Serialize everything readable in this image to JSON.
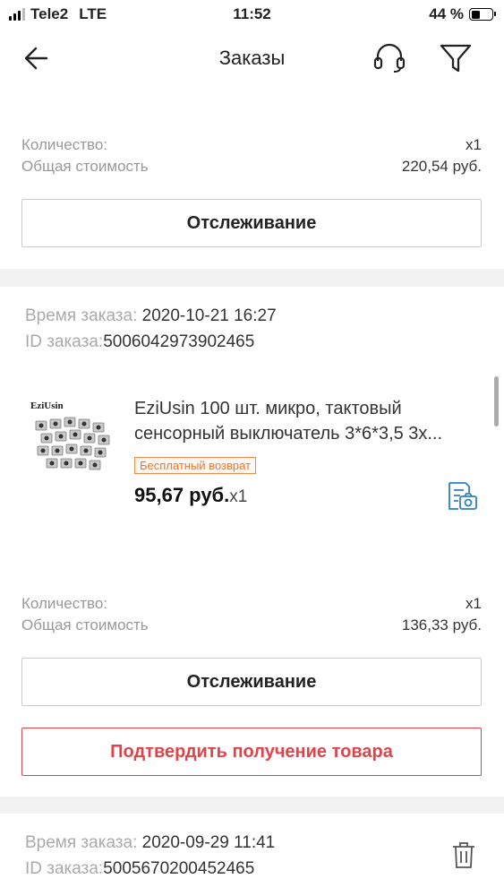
{
  "status_bar": {
    "carrier": "Tele2",
    "network": "LTE",
    "time": "11:52",
    "battery": "44 %",
    "battery_level": 0.44
  },
  "header": {
    "title": "Заказы",
    "back_icon": "arrow-left-icon",
    "support_icon": "headset-icon",
    "filter_icon": "filter-icon"
  },
  "orders": [
    {
      "quantity_label": "Количество:",
      "quantity_value": "x1",
      "total_label": "Общая стоимость",
      "total_value": "220,54 руб.",
      "track_button": "Отслеживание"
    },
    {
      "time_label": "Время заказа:",
      "time_value": "2020-10-21 16:27",
      "id_label": "ID заказа:",
      "id_value": "5006042973902465",
      "product": {
        "image_brand": "EziUsin",
        "title": "EziUsin 100 шт. микро, тактовый сенсорный выключатель 3*6*3,5 3х...",
        "badge": "Бесплатный возврат",
        "price": "95,67 руб.",
        "qty": "x1"
      },
      "quantity_label": "Количество:",
      "quantity_value": "x1",
      "total_label": "Общая стоимость",
      "total_value": "136,33 руб.",
      "track_button": "Отслеживание",
      "confirm_button": "Подтвердить получение товара"
    },
    {
      "time_label": "Время заказа:",
      "time_value": "2020-09-29 11:41",
      "id_label": "ID заказа:",
      "id_value": "5005670200452465",
      "delete_icon": "trash-icon"
    }
  ],
  "colors": {
    "accent_red": "#e0434a",
    "badge_orange": "#f0752c",
    "icon_blue": "#2f7fc1"
  }
}
